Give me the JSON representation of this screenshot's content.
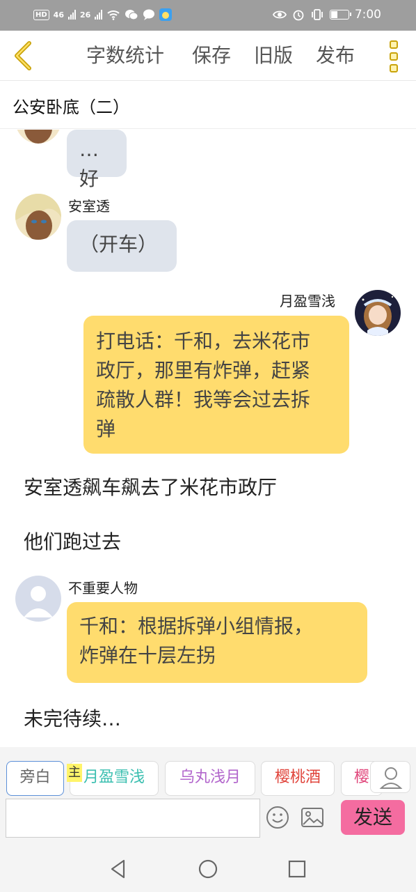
{
  "status_bar": {
    "left_badges": [
      "HD",
      "46",
      "26"
    ],
    "time": "7:00"
  },
  "toolbar": {
    "word_count": "字数统计",
    "save": "保存",
    "old_version": "旧版",
    "publish": "发布"
  },
  "chapter": {
    "title": "公安卧底（二）"
  },
  "chat": {
    "msg1": {
      "text": "…好"
    },
    "msg2": {
      "name": "安室透",
      "text": "（开车）"
    },
    "msg3": {
      "name": "月盈雪浅",
      "line1": "打电话：千和，去米花市",
      "line2": "政厅，那里有炸弹，赶紧",
      "line3": "疏散人群！我等会过去拆",
      "line4": "弹"
    },
    "narration1": "安室透飙车飙去了米花市政厅",
    "narration2": "他们跑过去",
    "msg4": {
      "name": "不重要人物",
      "line1": "千和：根据拆弹小组情报，",
      "line2": "炸弹在十层左拐"
    },
    "narration3": "未完待续…"
  },
  "bottom": {
    "roles": [
      "旁白",
      "月盈雪浅",
      "乌丸浅月",
      "樱桃酒",
      "樱"
    ],
    "role_colors": [
      "#666666",
      "#3bbfb0",
      "#b266cc",
      "#e0433a",
      "#e0457a"
    ],
    "main_badge": "主",
    "input_placeholder": "",
    "send": "发送"
  }
}
